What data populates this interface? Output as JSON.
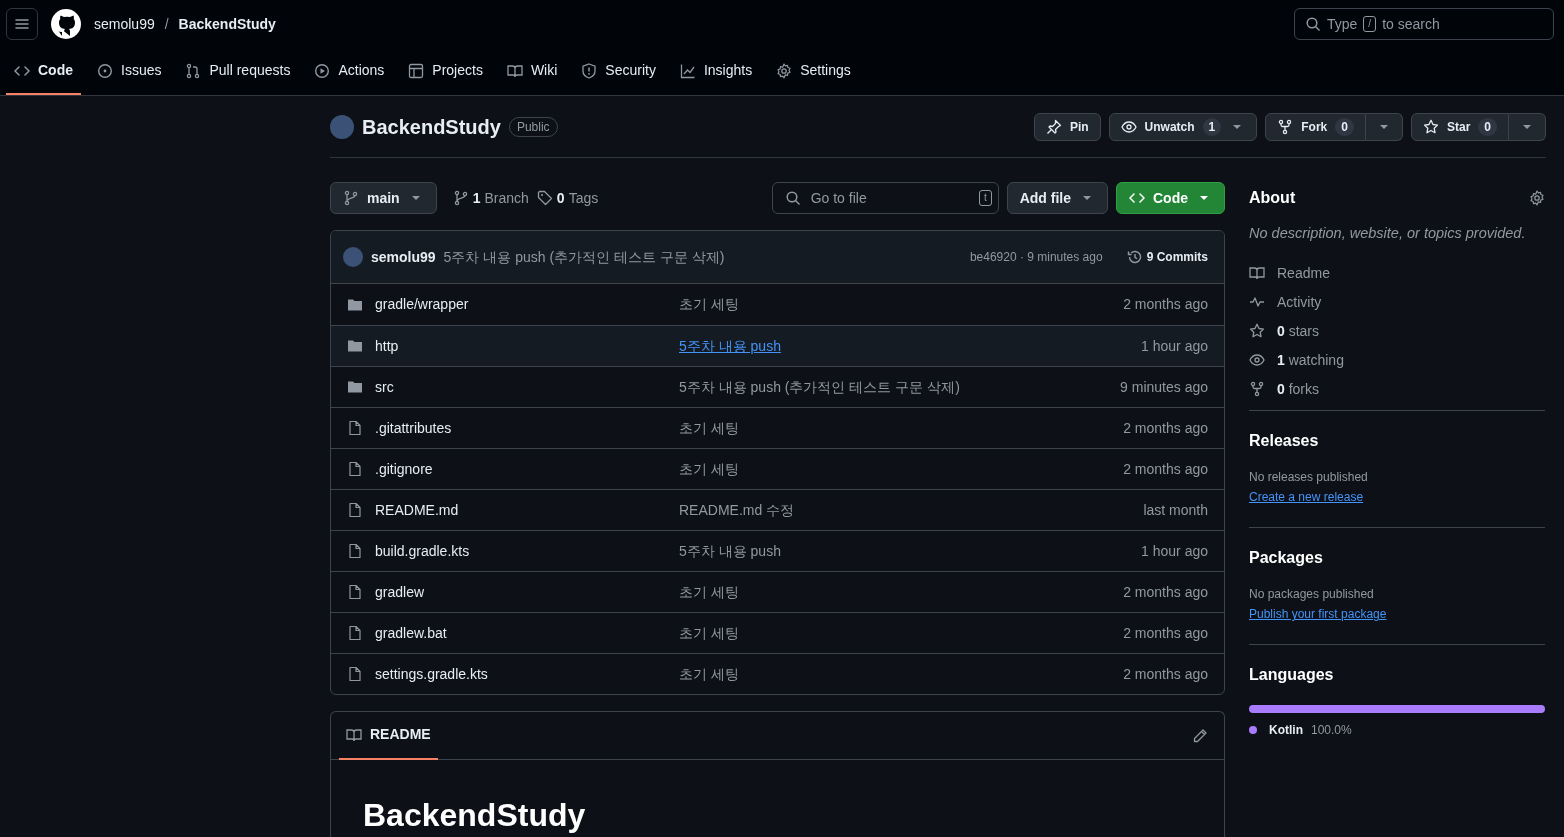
{
  "header": {
    "owner": "semolu99",
    "separator": "/",
    "repo": "BackendStudy",
    "search": {
      "before": "Type",
      "key": "/",
      "after": "to search"
    }
  },
  "repo_nav": [
    {
      "label": "Code",
      "selected": true
    },
    {
      "label": "Issues",
      "selected": false
    },
    {
      "label": "Pull requests",
      "selected": false
    },
    {
      "label": "Actions",
      "selected": false
    },
    {
      "label": "Projects",
      "selected": false
    },
    {
      "label": "Wiki",
      "selected": false
    },
    {
      "label": "Security",
      "selected": false
    },
    {
      "label": "Insights",
      "selected": false
    },
    {
      "label": "Settings",
      "selected": false
    }
  ],
  "repo": {
    "name": "BackendStudy",
    "visibility": "Public"
  },
  "actions": [
    {
      "kind": "plain",
      "label": "Pin"
    },
    {
      "kind": "dropdown",
      "label": "Unwatch",
      "count": "1"
    },
    {
      "kind": "split",
      "label": "Fork",
      "count": "0"
    },
    {
      "kind": "split",
      "label": "Star",
      "count": "0"
    }
  ],
  "toolbar": {
    "branch": "main",
    "branch_count": "1",
    "branch_label": "Branch",
    "tag_count": "0",
    "tag_label": "Tags",
    "file_search": {
      "placeholder": "Go to file",
      "shortcut": "t"
    },
    "add_file": "Add file",
    "code": "Code"
  },
  "latest_commit": {
    "author": "semolu99",
    "message": "5주차 내용 push (추가적인 테스트 구문 삭제)",
    "sha_time": "be46920 · 9 minutes ago",
    "commits": "9 Commits"
  },
  "files": [
    {
      "kind": "folder",
      "name": "gradle/wrapper",
      "message": "초기 세팅",
      "time": "2 months ago",
      "highlighted": false
    },
    {
      "kind": "folder",
      "name": "http",
      "message": "5주차 내용 push",
      "time": "1 hour ago",
      "highlighted": true
    },
    {
      "kind": "folder",
      "name": "src",
      "message": "5주차 내용 push (추가적인 테스트 구문 삭제)",
      "time": "9 minutes ago",
      "highlighted": false
    },
    {
      "kind": "file",
      "name": ".gitattributes",
      "message": "초기 세팅",
      "time": "2 months ago",
      "highlighted": false
    },
    {
      "kind": "file",
      "name": ".gitignore",
      "message": "초기 세팅",
      "time": "2 months ago",
      "highlighted": false
    },
    {
      "kind": "file",
      "name": "README.md",
      "message": "README.md 수정",
      "time": "last month",
      "highlighted": false
    },
    {
      "kind": "file",
      "name": "build.gradle.kts",
      "message": "5주차 내용 push",
      "time": "1 hour ago",
      "highlighted": false
    },
    {
      "kind": "file",
      "name": "gradlew",
      "message": "초기 세팅",
      "time": "2 months ago",
      "highlighted": false
    },
    {
      "kind": "file",
      "name": "gradlew.bat",
      "message": "초기 세팅",
      "time": "2 months ago",
      "highlighted": false
    },
    {
      "kind": "file",
      "name": "settings.gradle.kts",
      "message": "초기 세팅",
      "time": "2 months ago",
      "highlighted": false
    }
  ],
  "readme": {
    "tab": "README",
    "selected": true,
    "title": "BackendStudy"
  },
  "about": {
    "title": "About",
    "description": "No description, website, or topics provided.",
    "links": [
      {
        "label": "Readme"
      },
      {
        "label": "Activity"
      },
      {
        "label": "**0** stars"
      },
      {
        "label": "**1** watching"
      },
      {
        "label": "**0** forks"
      }
    ]
  },
  "releases": {
    "title": "Releases",
    "note": "No releases published",
    "link": "Create a new release"
  },
  "packages": {
    "title": "Packages",
    "note": "No packages published",
    "link": "Publish your first package"
  },
  "languages": {
    "title": "Languages",
    "items": [
      {
        "name": "Kotlin",
        "percent": "100.0%",
        "color": "#a97bff",
        "level": 1
      }
    ]
  }
}
